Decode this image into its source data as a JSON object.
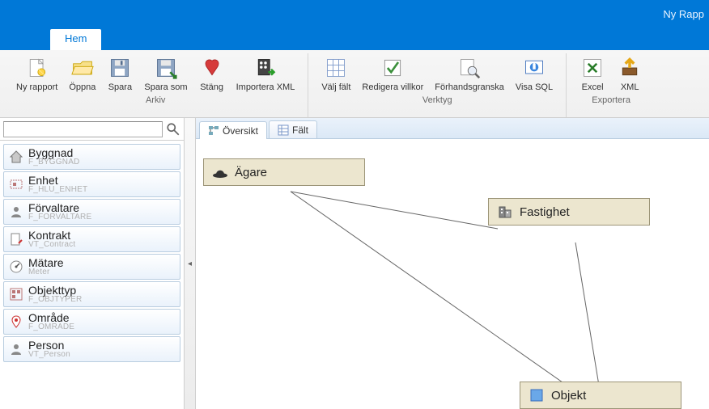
{
  "window": {
    "title": "Ny Rapp"
  },
  "ribbon": {
    "tab": "Hem",
    "groups": {
      "arkiv": {
        "label": "Arkiv",
        "buttons": {
          "new": "Ny rapport",
          "open": "Öppna",
          "save": "Spara",
          "saveas": "Spara som",
          "close": "Stäng",
          "import": "Importera XML"
        }
      },
      "verktyg": {
        "label": "Verktyg",
        "buttons": {
          "select_fields": "Välj fält",
          "edit_conditions": "Redigera villkor",
          "preview": "Förhandsgranska",
          "show_sql": "Visa SQL"
        }
      },
      "exportera": {
        "label": "Exportera",
        "buttons": {
          "excel": "Excel",
          "xml": "XML"
        }
      }
    }
  },
  "search": {
    "placeholder": ""
  },
  "entities": [
    {
      "title": "Byggnad",
      "sub": "F_BYGGNAD",
      "icon": "house"
    },
    {
      "title": "Enhet",
      "sub": "F_HLU_ENHET",
      "icon": "unit"
    },
    {
      "title": "Förvaltare",
      "sub": "F_FORVALTARE",
      "icon": "person"
    },
    {
      "title": "Kontrakt",
      "sub": "VT_Contract",
      "icon": "doc"
    },
    {
      "title": "Mätare",
      "sub": "Meter",
      "icon": "gauge"
    },
    {
      "title": "Objekttyp",
      "sub": "F_OBJTYPER",
      "icon": "grid"
    },
    {
      "title": "Område",
      "sub": "F_OMRADE",
      "icon": "pin"
    },
    {
      "title": "Person",
      "sub": "VT_Person",
      "icon": "person"
    }
  ],
  "tabs": {
    "overview": "Översikt",
    "fields": "Fält"
  },
  "nodes": {
    "owner": "Ägare",
    "property": "Fastighet",
    "object": "Objekt"
  }
}
